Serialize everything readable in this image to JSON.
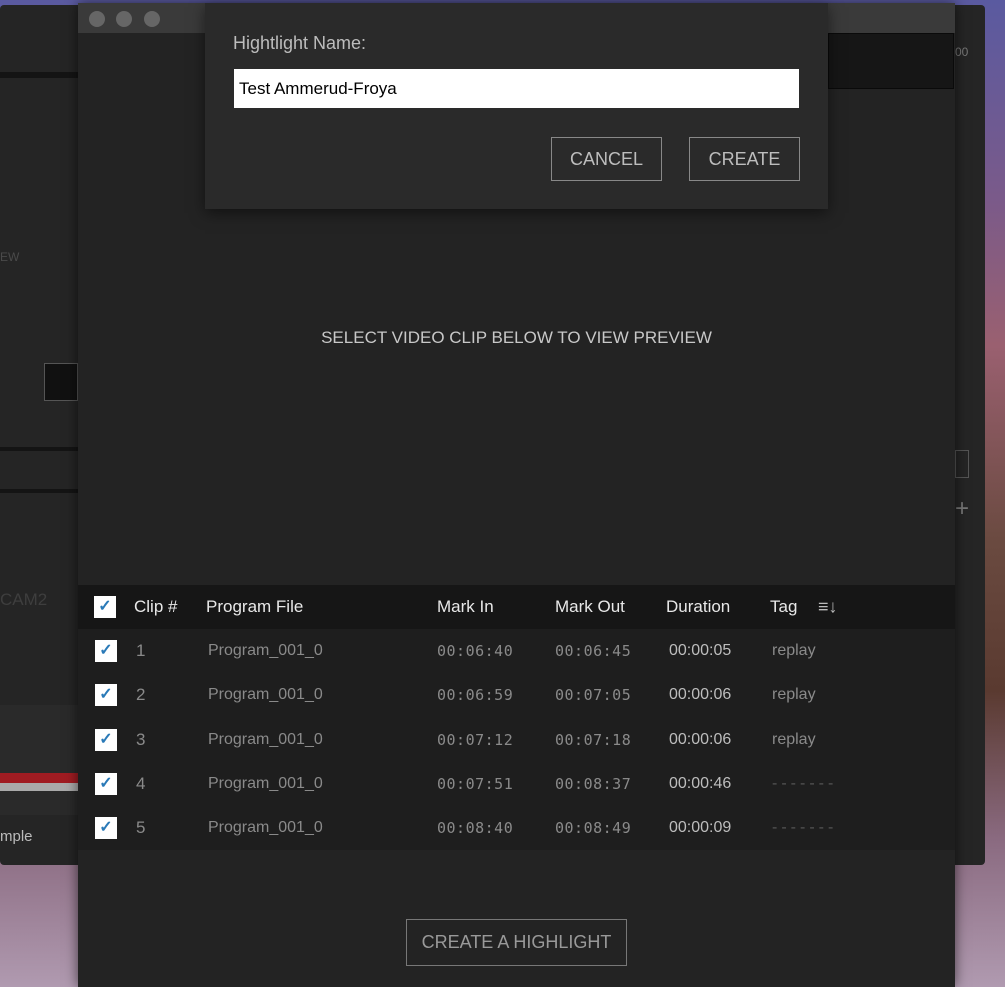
{
  "background_app": {
    "fragments": {
      "preview_tail": "EW",
      "cam": "CAM2",
      "sample": "mple",
      "top_right": "00"
    }
  },
  "window": {
    "buttons": [
      "close",
      "minimize",
      "zoom"
    ]
  },
  "dialog": {
    "label": "Hightlight Name:",
    "value": "Test Ammerud-Froya",
    "cancel": "CANCEL",
    "create": "CREATE"
  },
  "preview": {
    "message": "SELECT VIDEO CLIP BELOW TO VIEW PREVIEW"
  },
  "table": {
    "select_all": true,
    "headers": {
      "clip": "Clip #",
      "program": "Program File",
      "mark_in": "Mark In",
      "mark_out": "Mark Out",
      "duration": "Duration",
      "tag": "Tag"
    },
    "sort_icon": "sort-descending-icon",
    "rows": [
      {
        "checked": true,
        "clip": "1",
        "program": "Program_001_0",
        "mark_in": "00:06:40",
        "mark_out": "00:06:45",
        "duration": "00:00:05",
        "tag": "replay"
      },
      {
        "checked": true,
        "clip": "2",
        "program": "Program_001_0",
        "mark_in": "00:06:59",
        "mark_out": "00:07:05",
        "duration": "00:00:06",
        "tag": "replay"
      },
      {
        "checked": true,
        "clip": "3",
        "program": "Program_001_0",
        "mark_in": "00:07:12",
        "mark_out": "00:07:18",
        "duration": "00:00:06",
        "tag": "replay"
      },
      {
        "checked": true,
        "clip": "4",
        "program": "Program_001_0",
        "mark_in": "00:07:51",
        "mark_out": "00:08:37",
        "duration": "00:00:46",
        "tag": "-------"
      },
      {
        "checked": true,
        "clip": "5",
        "program": "Program_001_0",
        "mark_in": "00:08:40",
        "mark_out": "00:08:49",
        "duration": "00:00:09",
        "tag": "-------"
      }
    ]
  },
  "footer": {
    "create_highlight": "CREATE A HIGHLIGHT"
  },
  "colors": {
    "checkmark": "#2a7ab8",
    "accent_red": "#a01c22"
  }
}
